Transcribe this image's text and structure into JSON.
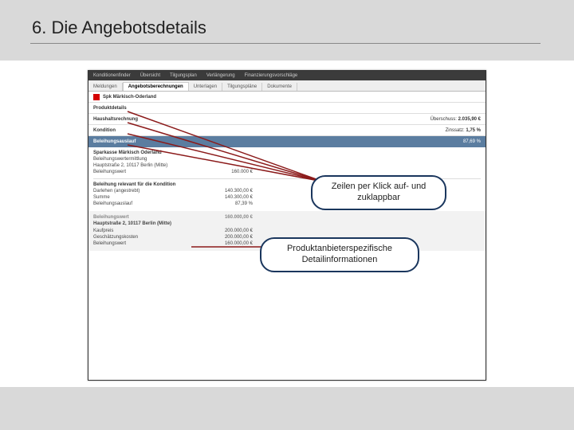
{
  "slide": {
    "title": "6. Die Angebotsdetails"
  },
  "darkbar": {
    "items": [
      "Konditionenfinder",
      "Übersicht",
      "Tilgungsplan",
      "Verlängerung",
      "Finanzierungsvorschläge"
    ]
  },
  "tabs": [
    "Meldungen",
    "Angebotsberechnungen",
    "Unterlagen",
    "Tilgungspläne",
    "Dokumente"
  ],
  "bank": {
    "name": "Spk Märkisch-Oderland"
  },
  "sections": {
    "produktdetails": {
      "label": "Produktdetails"
    },
    "haushalt": {
      "label": "Haushaltsrechnung",
      "valueLabel": "Überschuss:",
      "value": "2.035,90 €"
    },
    "kondition": {
      "label": "Kondition",
      "valueLabel": "Zinssatz:",
      "value": "1,75 %"
    },
    "auslauf": {
      "label": "Beleihungsauslauf",
      "value": "87,69 %"
    },
    "bwe": {
      "title": "Sparkasse Märkisch Oderland",
      "sub": "Beleihungswertermittlung",
      "addr1": "Hauptstraße 2, 10117 Berlin (Mitte)",
      "addr2": "Beleihungswert",
      "bwVal": "160.000 €"
    },
    "relevant": {
      "title": "Beleihung relevant für die Kondition",
      "r1l": "Darlehen (angestrebt)",
      "r1v": "140.300,00 €",
      "r2l": "Summe",
      "r2v": "140.300,00 €",
      "r3l": "Beleihungsauslauf",
      "r3v": "87,39 %"
    },
    "grey": {
      "headL": "Beleihungswert",
      "headR": "160.000,00 €",
      "addr": "Hauptstraße 2, 10117 Berlin (Mitte)",
      "r1l": "Kaufpreis",
      "r1v": "200.000,00 €",
      "r2l": "Geschätzungskosten",
      "r2v": "200.000,00 €",
      "r3l": "Beleihungswert",
      "r3v": "160.000,00 €"
    }
  },
  "callouts": {
    "c1a": "Zeilen per Klick auf- und",
    "c1b": "zuklappbar",
    "c2a": "Produktanbieterspezifische",
    "c2b": "Detailinformationen"
  }
}
